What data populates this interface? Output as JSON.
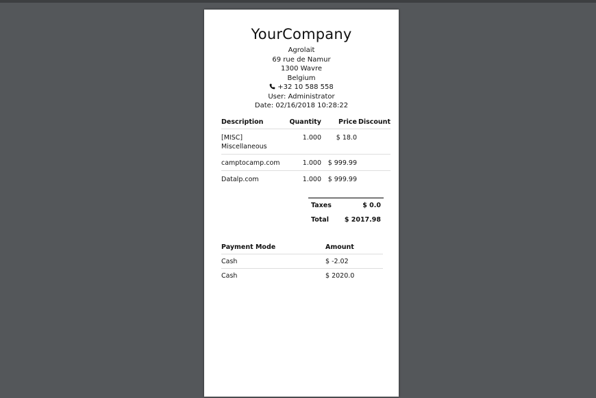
{
  "receipt": {
    "company": "YourCompany",
    "address": [
      "Agrolait",
      "69 rue de Namur",
      "1300 Wavre",
      "Belgium"
    ],
    "phone": "+32 10 588 558",
    "user": "User: Administrator",
    "date": "Date: 02/16/2018 10:28:22",
    "headers": {
      "description": "Description",
      "quantity": "Quantity",
      "price": "Price",
      "discount": "Discount"
    },
    "lines": [
      {
        "description": "[MISC] Miscellaneous",
        "quantity": "1.000",
        "price": "$ 18.0",
        "discount": ""
      },
      {
        "description": "camptocamp.com",
        "quantity": "1.000",
        "price": "$ 999.99",
        "discount": ""
      },
      {
        "description": "Datalp.com",
        "quantity": "1.000",
        "price": "$ 999.99",
        "discount": ""
      }
    ],
    "totals": {
      "taxes_label": "Taxes",
      "taxes_value": "$ 0.0",
      "total_label": "Total",
      "total_value": "$ 2017.98"
    },
    "payment_headers": {
      "mode": "Payment Mode",
      "amount": "Amount"
    },
    "payments": [
      {
        "mode": "Cash",
        "amount": "$ -2.02"
      },
      {
        "mode": "Cash",
        "amount": "$ 2020.0"
      }
    ]
  },
  "icons": {
    "phone": "phone-icon"
  }
}
